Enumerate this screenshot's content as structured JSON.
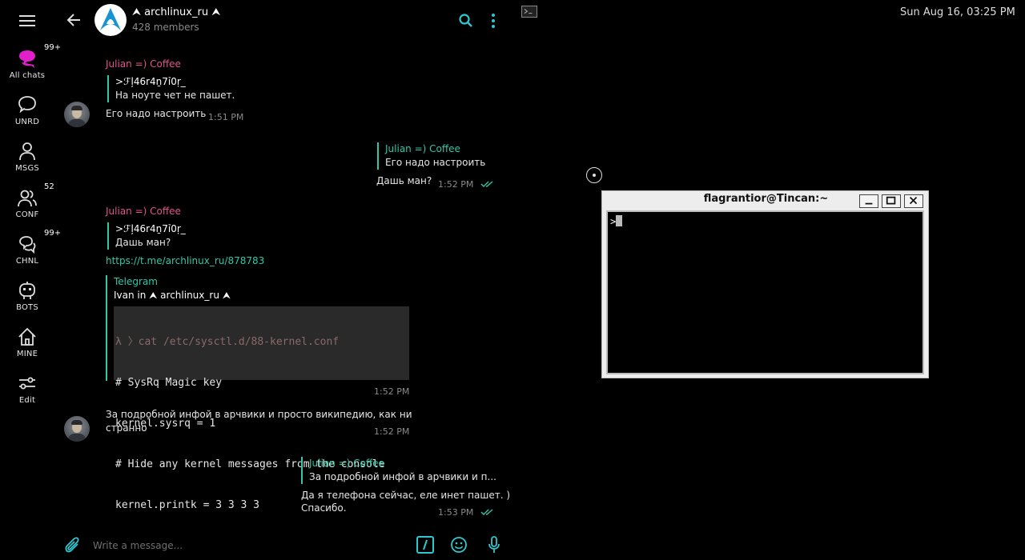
{
  "sidebar": {
    "items": [
      {
        "label": "All chats",
        "badge": "99+"
      },
      {
        "label": "UNRD",
        "badge": ""
      },
      {
        "label": "MSGS",
        "badge": ""
      },
      {
        "label": "CONF",
        "badge": "52"
      },
      {
        "label": "CHNL",
        "badge": "99+"
      },
      {
        "label": "BOTS",
        "badge": ""
      },
      {
        "label": "MINE",
        "badge": ""
      },
      {
        "label": "Edit",
        "badge": ""
      }
    ]
  },
  "header": {
    "title": "⮝ archlinux_ru ⮝",
    "subtitle": "428 members"
  },
  "messages": {
    "m1": {
      "sender": "Julian =) Coffee",
      "reply_name": ">ℱļ46r4ṉ7ỉ0ṛ_",
      "reply_text": "На ноуте чет не пашет.",
      "text": "Его надо настроить",
      "time": "1:51 PM"
    },
    "m2": {
      "reply_name": "Julian =) Coffee",
      "reply_text": "Его надо настроить",
      "text": "Дашь ман?",
      "time": "1:52 PM"
    },
    "m3": {
      "sender": "Julian =) Coffee",
      "reply_name": ">ℱļ46r4ṉ7ỉ0ṛ_",
      "reply_text": "Дашь ман?",
      "link": "https://t.me/archlinux_ru/878783",
      "preview_site": "Telegram",
      "preview_title": "Ivan in ⮝ archlinux_ru ⮝",
      "code_lines": [
        "λ 〉cat /etc/sysctl.d/88-kernel.conf",
        "# SysRq Magic key",
        "kernel.sysrq = 1",
        "# Hide any kernel messages from the console",
        "kernel.printk = 3 3 3 3"
      ],
      "time": "1:52 PM"
    },
    "m4": {
      "text_line1": "За подробной инфой в арчвики и просто википедию, как ни",
      "text_line2": "странно",
      "time": "1:52 PM"
    },
    "m5": {
      "reply_name": "Julian =) Coffee",
      "reply_text": "За подробной инфой в арчвики и п...",
      "text_line1": "Да я телефона сейчас, еле инет пашет. )",
      "text_line2": "Спасибо.",
      "time": "1:53 PM"
    }
  },
  "composer": {
    "placeholder": "Write a message..."
  },
  "desktop": {
    "clock": "Sun Aug 16, 03:25 PM"
  },
  "terminal": {
    "title": "flagrantior@Tincan:~",
    "prompt": ">"
  },
  "colors": {
    "accent": "#2fc8a8",
    "sender_pink": "#e0548c",
    "badge_magenta": "#e020c8"
  }
}
